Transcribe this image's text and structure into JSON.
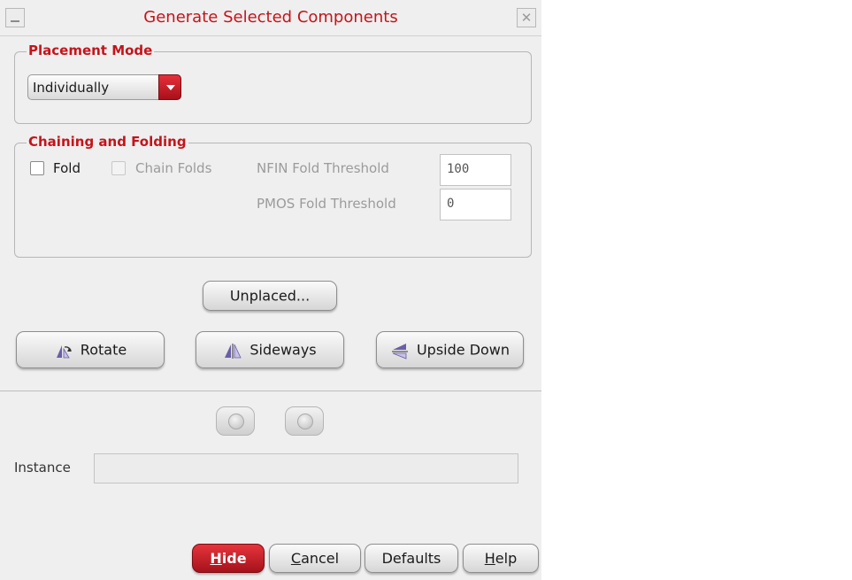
{
  "window": {
    "title": "Generate Selected Components",
    "minimize_icon": "minimize-icon",
    "close_icon": "close-icon",
    "close_glyph": "✕"
  },
  "placement_mode": {
    "legend": "Placement Mode",
    "selected": "Individually"
  },
  "chaining": {
    "legend": "Chaining and Folding",
    "fold_label": "Fold",
    "fold_checked": false,
    "chain_folds_label": "Chain Folds",
    "chain_folds_checked": false,
    "nfin_label": "NFIN Fold Threshold",
    "nfin_value": "100",
    "pmos_label": "PMOS Fold Threshold",
    "pmos_value": "0"
  },
  "buttons": {
    "unplaced": "Unplaced...",
    "rotate": "Rotate",
    "sideways": "Sideways",
    "upside_down": "Upside Down"
  },
  "navigation": {
    "prev_icon": "previous-icon",
    "next_icon": "next-icon"
  },
  "instance": {
    "label": "Instance",
    "value": ""
  },
  "footer": {
    "hide_mnemonic": "H",
    "hide_rest": "ide",
    "cancel_mnemonic": "C",
    "cancel_rest": "ancel",
    "defaults": "Defaults",
    "help_mnemonic": "H",
    "help_rest": "elp"
  },
  "colors": {
    "accent_red": "#c4141b",
    "dialog_bg": "#efefef"
  }
}
